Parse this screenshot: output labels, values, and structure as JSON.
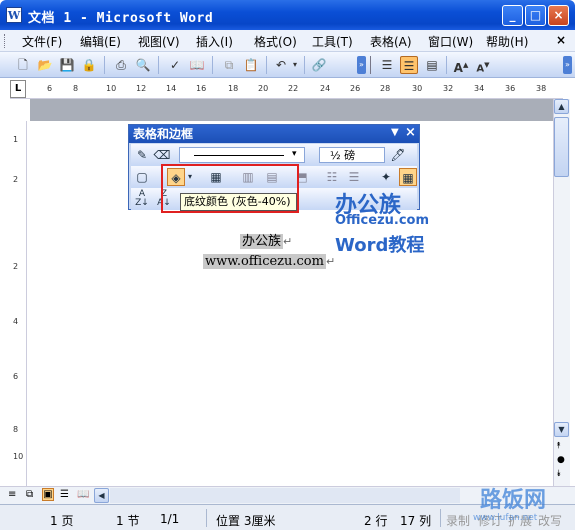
{
  "window": {
    "title": "文档 1 - Microsoft Word",
    "icon_label": "W"
  },
  "caption_buttons": [
    "_",
    "□",
    "×"
  ],
  "menu": {
    "items": [
      "文件(F)",
      "编辑(E)",
      "视图(V)",
      "插入(I)",
      "格式(O)",
      "工具(T)",
      "表格(A)",
      "窗口(W)",
      "帮助(H)"
    ],
    "help_close": "×"
  },
  "toolbar": {
    "buttons": [
      "new-doc",
      "open",
      "save",
      "permission",
      "print",
      "print-preview",
      "spelling",
      "research",
      "copy",
      "paste",
      "undo",
      "hyperlink"
    ],
    "right_buttons": [
      "justify",
      "align-center",
      "distributed",
      "font-grow",
      "font-shrink"
    ]
  },
  "ruler": {
    "corner": "L",
    "numbers": [
      "6",
      "8",
      "10",
      "12",
      "14",
      "16",
      "18",
      "20",
      "22",
      "24",
      "26",
      "28",
      "30",
      "32",
      "34",
      "36",
      "38"
    ]
  },
  "vruler": {
    "numbers": [
      "1",
      "2",
      "2",
      "4",
      "6",
      "8",
      "10"
    ]
  },
  "panel": {
    "title": "表格和边框",
    "line_weight": "½ 磅",
    "tooltip": "底纹颜色 (灰色-40%)"
  },
  "watermark": {
    "line1": "办公族",
    "line2": "Officezu.com",
    "line3": "Word教程"
  },
  "document": {
    "line1": "办公族",
    "line2": "www.officezu.com"
  },
  "status": {
    "page": "1 页",
    "section": "1 节",
    "pages": "1/1",
    "position": "位置 3厘米",
    "line": "2 行",
    "col": "17 列",
    "rec": "录制",
    "rev": "修订",
    "ext": "扩展",
    "ovr": "改写"
  },
  "footer_watermark": {
    "line1": "路饭网",
    "line2": "www.lufan.net"
  },
  "colors": {
    "titlebar": "#0a4fd6",
    "highlight": "#ffc36b",
    "red_box": "#e02020",
    "shade_grey": "#c8c8c8"
  }
}
